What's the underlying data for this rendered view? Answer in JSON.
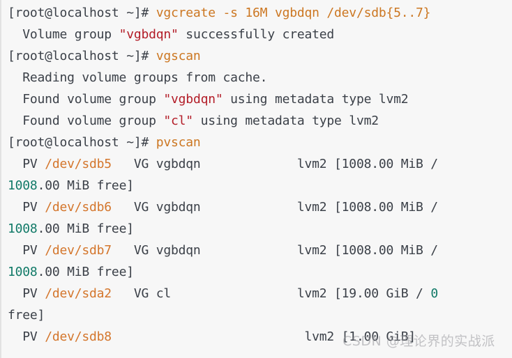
{
  "terminal": {
    "background_color": "#f7f7f7",
    "default_text_color": "#3b4048",
    "prompt_text": "[root@localhost ~]#",
    "colors": {
      "command": "#cc7722",
      "quoted_name": "#b31d28",
      "device_path": "#d4762c",
      "number": "#127a68",
      "plain": "#3b4048"
    },
    "lines": [
      {
        "id": "line-1",
        "kind": "prompt",
        "segments": [
          {
            "text": "[root@localhost ~]# ",
            "style": "prompt"
          },
          {
            "text": "vgcreate -s 16M vgbdqn /dev/sdb{5..7}",
            "style": "cmd"
          }
        ]
      },
      {
        "id": "line-2",
        "kind": "output",
        "segments": [
          {
            "text": "  Volume group ",
            "style": "plain"
          },
          {
            "text": "\"vgbdqn\"",
            "style": "quoted"
          },
          {
            "text": " successfully created",
            "style": "plain"
          }
        ]
      },
      {
        "id": "line-3",
        "kind": "prompt",
        "segments": [
          {
            "text": "[root@localhost ~]# ",
            "style": "prompt"
          },
          {
            "text": "vgscan",
            "style": "cmd"
          }
        ]
      },
      {
        "id": "line-4",
        "kind": "output",
        "segments": [
          {
            "text": "  Reading volume groups from cache.",
            "style": "plain"
          }
        ]
      },
      {
        "id": "line-5",
        "kind": "output",
        "segments": [
          {
            "text": "  Found volume group ",
            "style": "plain"
          },
          {
            "text": "\"vgbdqn\"",
            "style": "quoted"
          },
          {
            "text": " using metadata type lvm2",
            "style": "plain"
          }
        ]
      },
      {
        "id": "line-6",
        "kind": "output",
        "segments": [
          {
            "text": "  Found volume group ",
            "style": "plain"
          },
          {
            "text": "\"cl\"",
            "style": "quoted"
          },
          {
            "text": " using metadata type lvm2",
            "style": "plain"
          }
        ]
      },
      {
        "id": "line-7",
        "kind": "prompt",
        "segments": [
          {
            "text": "[root@localhost ~]# ",
            "style": "prompt"
          },
          {
            "text": "pvscan",
            "style": "cmd"
          }
        ]
      },
      {
        "id": "line-8",
        "kind": "output",
        "segments": [
          {
            "text": "  PV ",
            "style": "plain"
          },
          {
            "text": "/dev/sdb5",
            "style": "path"
          },
          {
            "text": "   VG vgbdqn             lvm2 [1008.00 MiB /",
            "style": "plain"
          }
        ]
      },
      {
        "id": "line-9",
        "kind": "output-wrap",
        "segments": [
          {
            "text": "1008",
            "style": "num"
          },
          {
            "text": ".00 MiB free]",
            "style": "plain"
          }
        ]
      },
      {
        "id": "line-10",
        "kind": "output",
        "segments": [
          {
            "text": "  PV ",
            "style": "plain"
          },
          {
            "text": "/dev/sdb6",
            "style": "path"
          },
          {
            "text": "   VG vgbdqn             lvm2 [1008.00 MiB /",
            "style": "plain"
          }
        ]
      },
      {
        "id": "line-11",
        "kind": "output-wrap",
        "segments": [
          {
            "text": "1008",
            "style": "num"
          },
          {
            "text": ".00 MiB free]",
            "style": "plain"
          }
        ]
      },
      {
        "id": "line-12",
        "kind": "output",
        "segments": [
          {
            "text": "  PV ",
            "style": "plain"
          },
          {
            "text": "/dev/sdb7",
            "style": "path"
          },
          {
            "text": "   VG vgbdqn             lvm2 [1008.00 MiB /",
            "style": "plain"
          }
        ]
      },
      {
        "id": "line-13",
        "kind": "output-wrap",
        "segments": [
          {
            "text": "1008",
            "style": "num"
          },
          {
            "text": ".00 MiB free]",
            "style": "plain"
          }
        ]
      },
      {
        "id": "line-14",
        "kind": "output",
        "segments": [
          {
            "text": "  PV ",
            "style": "plain"
          },
          {
            "text": "/dev/sda2",
            "style": "path"
          },
          {
            "text": "   VG cl                 lvm2 [19.00 GiB / ",
            "style": "plain"
          },
          {
            "text": "0",
            "style": "num"
          }
        ]
      },
      {
        "id": "line-15",
        "kind": "output-wrap",
        "segments": [
          {
            "text": "free]",
            "style": "plain"
          }
        ]
      },
      {
        "id": "line-16",
        "kind": "output",
        "segments": [
          {
            "text": "  PV ",
            "style": "plain"
          },
          {
            "text": "/dev/sdb8",
            "style": "path"
          },
          {
            "text": "                          lvm2 [1.00 GiB]",
            "style": "plain"
          }
        ]
      }
    ]
  },
  "watermark": {
    "text": "CSDN @理论界的实战派"
  }
}
